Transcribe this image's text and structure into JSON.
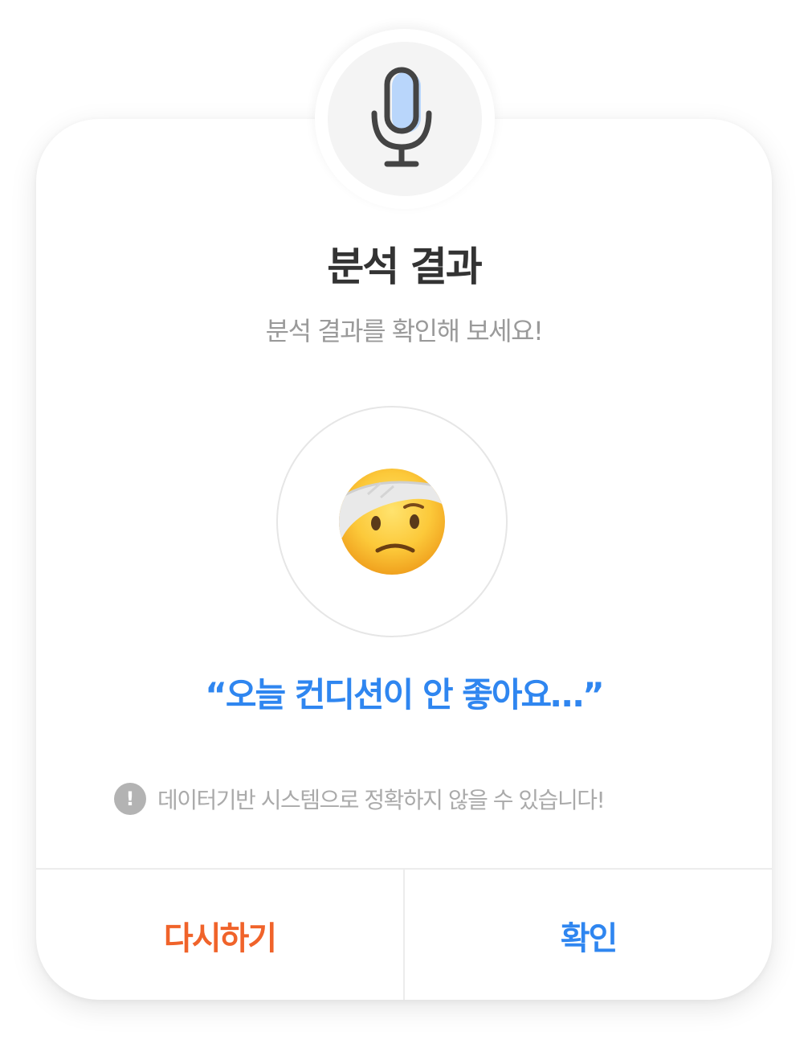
{
  "dialog": {
    "title": "분석 결과",
    "subtitle": "분석 결과를 확인해 보세요!",
    "result_emoji_icon": "face-with-head-bandage-icon",
    "result_quote": "“오늘 컨디션이 안 좋아요…”",
    "notice_icon_glyph": "!",
    "notice_text": "데이터기반 시스템으로 정확하지 않을 수 있습니다!"
  },
  "header": {
    "icon": "microphone-icon"
  },
  "footer": {
    "retry_label": "다시하기",
    "confirm_label": "확인"
  },
  "colors": {
    "accent_blue": "#2f86f0",
    "retry_orange": "#f0632a",
    "title_text": "#333333",
    "muted_text": "#9a9a9a",
    "mic_fill": "#b9d6fb",
    "mic_stroke": "#444444"
  }
}
